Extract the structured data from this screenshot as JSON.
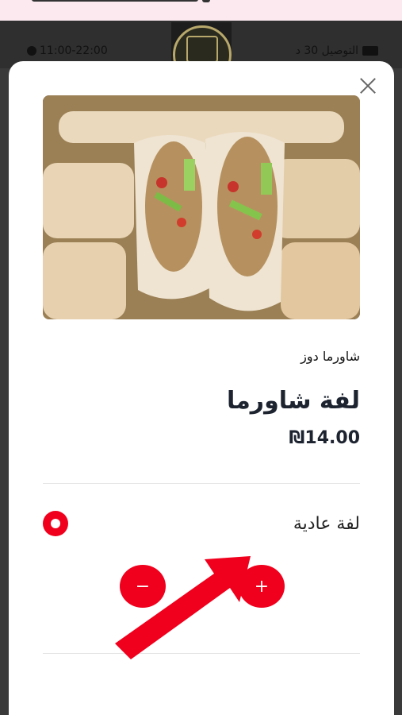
{
  "header": {
    "hours": "11:00-22:00",
    "delivery": "التوصيل 30 د",
    "icons": {
      "hours": "stopwatch-icon",
      "delivery": "truck-icon"
    }
  },
  "modal": {
    "category": "شاورما دوز",
    "title": "لفة شاورما",
    "price": "₪14.00",
    "option": {
      "label": "لفة عادية",
      "selected": true
    },
    "quantity": {
      "minus": "−",
      "plus": "+"
    }
  },
  "colors": {
    "accent": "#f0001c",
    "text": "#1d2430"
  }
}
